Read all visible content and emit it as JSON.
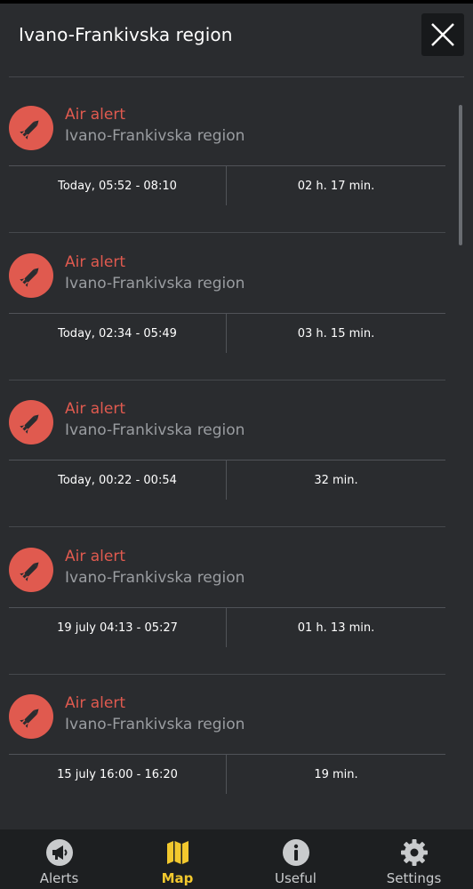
{
  "header": {
    "title": "Ivano-Frankivska region"
  },
  "alerts": [
    {
      "title": "Air alert",
      "region": "Ivano-Frankivska region",
      "time": "Today, 05:52 - 08:10",
      "duration": "02 h. 17 min."
    },
    {
      "title": "Air alert",
      "region": "Ivano-Frankivska region",
      "time": "Today, 02:34 - 05:49",
      "duration": "03 h. 15 min."
    },
    {
      "title": "Air alert",
      "region": "Ivano-Frankivska region",
      "time": "Today, 00:22 - 00:54",
      "duration": "32 min."
    },
    {
      "title": "Air alert",
      "region": "Ivano-Frankivska region",
      "time": "19 july 04:13 - 05:27",
      "duration": "01 h. 13 min."
    },
    {
      "title": "Air alert",
      "region": "Ivano-Frankivska region",
      "time": "15 july 16:00 - 16:20",
      "duration": "19 min."
    }
  ],
  "nav": {
    "alerts": "Alerts",
    "map": "Map",
    "useful": "Useful",
    "settings": "Settings",
    "active": "map"
  },
  "icons": {
    "alert": "missile-icon",
    "close": "close-icon",
    "alerts_tab": "megaphone-icon",
    "map_tab": "map-icon",
    "useful_tab": "info-icon",
    "settings_tab": "gear-icon"
  },
  "colors": {
    "accent_red": "#e05a4f",
    "active_yellow": "#f2c82e",
    "background": "#2a2c2f"
  }
}
